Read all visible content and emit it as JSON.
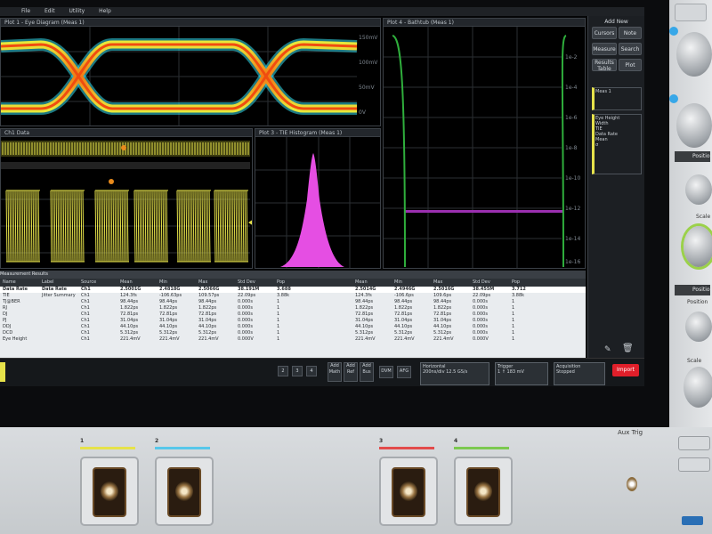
{
  "menubar": {
    "items": [
      "File",
      "Edit",
      "Utility",
      "Help"
    ]
  },
  "plots": {
    "eye_title": "Plot 1 - Eye Diagram (Meas 1)",
    "waveform_title": "Ch1  Data",
    "tie_title": "Plot 3 - TIE Histogram (Meas 1)",
    "bathtub_title": "Plot 4 - Bathtub (Meas 1)",
    "eye_yticks": [
      "150mV",
      "100mV",
      "50mV",
      "0V"
    ],
    "bathtub_yticks": [
      "1e-2",
      "1e-4",
      "1e-6",
      "1e-8",
      "1e-10",
      "1e-12",
      "1e-14",
      "1e-16"
    ]
  },
  "sidebar": {
    "title": "Add New",
    "buttons": [
      "Cursors",
      "Note",
      "Measure",
      "Search",
      "Results Table",
      "Plot"
    ],
    "meas_header": "Meas 1",
    "meas_lines": [
      "Eye Height",
      "Width",
      "TIE",
      "Data Rate",
      "Mean",
      "σ"
    ]
  },
  "results": {
    "title": "Measurement Results",
    "headers": [
      "Name",
      "Label",
      "Source",
      "Mean",
      "Min",
      "Max",
      "Std Dev",
      "Pop",
      "",
      "Mean",
      "Min",
      "Max",
      "Std Dev",
      "Pop"
    ],
    "rows": [
      [
        "Data Rate",
        "Data Rate",
        "Ch1",
        "2.5001G",
        "2.4818G",
        "2.5066G",
        "38.191M",
        "3.688",
        "",
        "2.5014G",
        "2.4946G",
        "2.5016G",
        "38.455M",
        "3.712"
      ],
      [
        "TIE",
        "Jitter Summary",
        "Ch1",
        "124.3fs",
        "-106.63ps",
        "109.57ps",
        "22.09ps",
        "3.88k",
        "",
        "124.3fs",
        "-106.6ps",
        "109.6ps",
        "22.09ps",
        "3.88k"
      ],
      [
        "TJ@BER",
        "",
        "Ch1",
        "98.44ps",
        "98.44ps",
        "98.44ps",
        "0.000s",
        "1",
        "",
        "98.44ps",
        "98.44ps",
        "98.44ps",
        "0.000s",
        "1"
      ],
      [
        "RJ",
        "",
        "Ch1",
        "1.822ps",
        "1.822ps",
        "1.822ps",
        "0.000s",
        "1",
        "",
        "1.822ps",
        "1.822ps",
        "1.822ps",
        "0.000s",
        "1"
      ],
      [
        "DJ",
        "",
        "Ch1",
        "72.81ps",
        "72.81ps",
        "72.81ps",
        "0.000s",
        "1",
        "",
        "72.81ps",
        "72.81ps",
        "72.81ps",
        "0.000s",
        "1"
      ],
      [
        "PJ",
        "",
        "Ch1",
        "31.04ps",
        "31.04ps",
        "31.04ps",
        "0.000s",
        "1",
        "",
        "31.04ps",
        "31.04ps",
        "31.04ps",
        "0.000s",
        "1"
      ],
      [
        "DDJ",
        "",
        "Ch1",
        "44.10ps",
        "44.10ps",
        "44.10ps",
        "0.000s",
        "1",
        "",
        "44.10ps",
        "44.10ps",
        "44.10ps",
        "0.000s",
        "1"
      ],
      [
        "DCD",
        "",
        "Ch1",
        "5.312ps",
        "5.312ps",
        "5.312ps",
        "0.000s",
        "1",
        "",
        "5.312ps",
        "5.312ps",
        "5.312ps",
        "0.000s",
        "1"
      ],
      [
        "Eye Height",
        "",
        "Ch1",
        "221.4mV",
        "221.4mV",
        "221.4mV",
        "0.000V",
        "1",
        "",
        "221.4mV",
        "221.4mV",
        "221.4mV",
        "0.000V",
        "1"
      ]
    ]
  },
  "statusbar": {
    "chips": [
      "2",
      "3",
      "4"
    ],
    "math_labels": [
      "Add Math",
      "Add Ref",
      "Add Bus"
    ],
    "box_labels": [
      "DVM",
      "AFG"
    ],
    "acq_title": "Horizontal",
    "acq_lines": [
      "200ns/div",
      "12.5 GS/s",
      "80 ps/pt"
    ],
    "trig_title": "Trigger",
    "trig_line": "1  ↑  183 mV",
    "acq2_title": "Acquisition",
    "acq2_lines": [
      "Stopped",
      "Analyze"
    ],
    "stop_label": "Import"
  },
  "frontpanel": {
    "channels": [
      "1",
      "2",
      "3",
      "4"
    ],
    "aux_label": "Aux Trig"
  },
  "rightpanel": {
    "position_label": "Position",
    "scale_label": "Scale",
    "position2_label": "Position",
    "scale2_label": "Scale"
  },
  "colors": {
    "ch1": "#e6e24a",
    "ch2": "#57c7ea",
    "ch3": "#e24b4b",
    "ch4": "#7cc94f",
    "histogram": "#e54ee3",
    "bathtub": "#2fae3c",
    "stop": "#e01f2a"
  }
}
